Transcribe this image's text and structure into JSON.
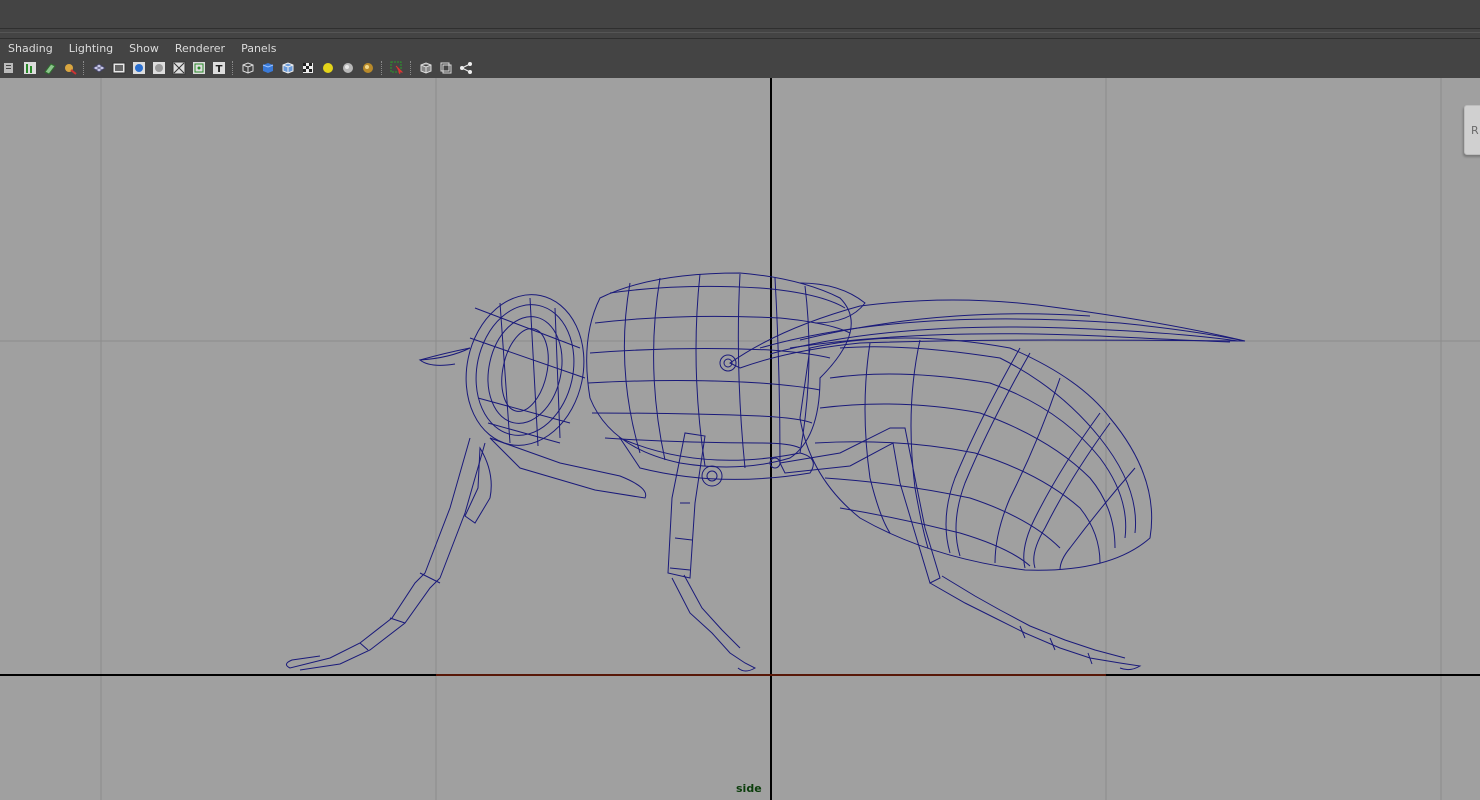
{
  "menubar": {
    "items": [
      {
        "label": "Shading"
      },
      {
        "label": "Lighting"
      },
      {
        "label": "Show"
      },
      {
        "label": "Renderer"
      },
      {
        "label": "Panels"
      }
    ]
  },
  "toolbar": {
    "icons": [
      "select-camera-icon",
      "camera-attributes-icon",
      "bookmarks-icon",
      "image-plane-icon",
      "grid-icon",
      "film-gate-icon",
      "resolution-gate-icon",
      "gate-mask-icon",
      "field-chart-icon",
      "safe-action-icon",
      "safe-title-icon",
      "wireframe-icon",
      "smooth-shade-icon",
      "wireframe-on-shaded-icon",
      "textured-icon",
      "use-all-lights-icon",
      "shadows-icon",
      "high-quality-icon",
      "isolate-select-icon",
      "xray-icon",
      "xray-joints-icon",
      "xray-components-icon"
    ]
  },
  "viewport": {
    "camera_label": "side",
    "side_tab_label": "R",
    "wire_color": "#1a1a7a",
    "background_color": "#a0a0a0",
    "axis_color": "#000000",
    "grid_color": "#8c8c8c",
    "ground_line_color": "#b03010"
  }
}
